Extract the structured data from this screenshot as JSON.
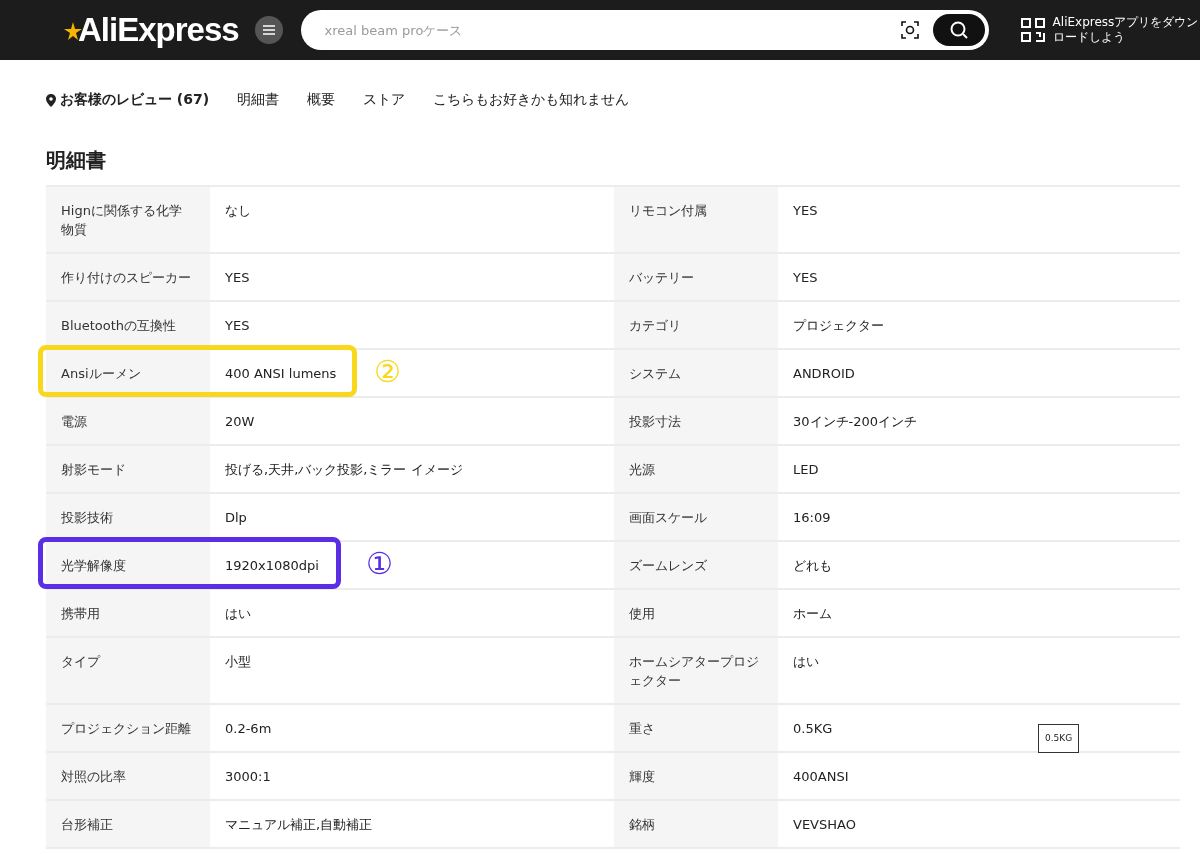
{
  "header": {
    "logo": "AliExpress",
    "search": {
      "placeholder": "xreal beam proケース"
    },
    "app_download": [
      "AliExpressアプリをダウン",
      "ロードしよう"
    ]
  },
  "nav": [
    {
      "label": "お客様のレビュー (67)",
      "selected": true
    },
    {
      "label": "明細書",
      "selected": false
    },
    {
      "label": "概要",
      "selected": false
    },
    {
      "label": "ストア",
      "selected": false
    },
    {
      "label": "こちらもお好きかも知れません",
      "selected": false
    }
  ],
  "section_title": "明細書",
  "spec_rows": [
    {
      "cells": [
        {
          "name": "Hignに関係する化学物質",
          "value": "なし"
        },
        {
          "name": "リモコン付属",
          "value": "YES"
        }
      ]
    },
    {
      "cells": [
        {
          "name": "作り付けのスピーカー",
          "value": "YES"
        },
        {
          "name": "バッテリー",
          "value": "YES"
        }
      ]
    },
    {
      "cells": [
        {
          "name": "Bluetoothの互換性",
          "value": "YES"
        },
        {
          "name": "カテゴリ",
          "value": "プロジェクター"
        }
      ]
    },
    {
      "cells": [
        {
          "name": "Ansiルーメン",
          "value": "400 ANSI lumens"
        },
        {
          "name": "システム",
          "value": "ANDROID"
        }
      ],
      "marker": {
        "label": "②",
        "color": "#f8d71c"
      }
    },
    {
      "cells": [
        {
          "name": "電源",
          "value": "20W"
        },
        {
          "name": "投影寸法",
          "value": "30インチ-200インチ"
        }
      ]
    },
    {
      "cells": [
        {
          "name": "射影モード",
          "value": "投げる,天井,バック投影,ミラー イメージ"
        },
        {
          "name": "光源",
          "value": "LED"
        }
      ]
    },
    {
      "cells": [
        {
          "name": "投影技術",
          "value": "Dlp"
        },
        {
          "name": "画面スケール",
          "value": "16:09"
        }
      ]
    },
    {
      "cells": [
        {
          "name": "光学解像度",
          "value": "1920x1080dpi"
        },
        {
          "name": "ズームレンズ",
          "value": "どれも"
        }
      ],
      "marker": {
        "label": "①",
        "color": "#5a2ee6"
      }
    },
    {
      "cells": [
        {
          "name": "携帯用",
          "value": "はい"
        },
        {
          "name": "使用",
          "value": "ホーム"
        }
      ]
    },
    {
      "cells": [
        {
          "name": "タイプ",
          "value": "小型"
        },
        {
          "name": "ホームシアタープロジェクター",
          "value": "はい"
        }
      ]
    },
    {
      "cells": [
        {
          "name": "プロジェクション距離",
          "value": "0.2-6m"
        },
        {
          "name": "重さ",
          "value": "0.5KG",
          "tooltip": "0.5KG"
        }
      ]
    },
    {
      "cells": [
        {
          "name": "対照の比率",
          "value": "3000:1"
        },
        {
          "name": "輝度",
          "value": "400ANSI"
        }
      ]
    },
    {
      "cells": [
        {
          "name": "台形補正",
          "value": "マニュアル補正,自動補正"
        },
        {
          "name": "銘柄",
          "value": "VEVSHAO"
        }
      ]
    }
  ]
}
